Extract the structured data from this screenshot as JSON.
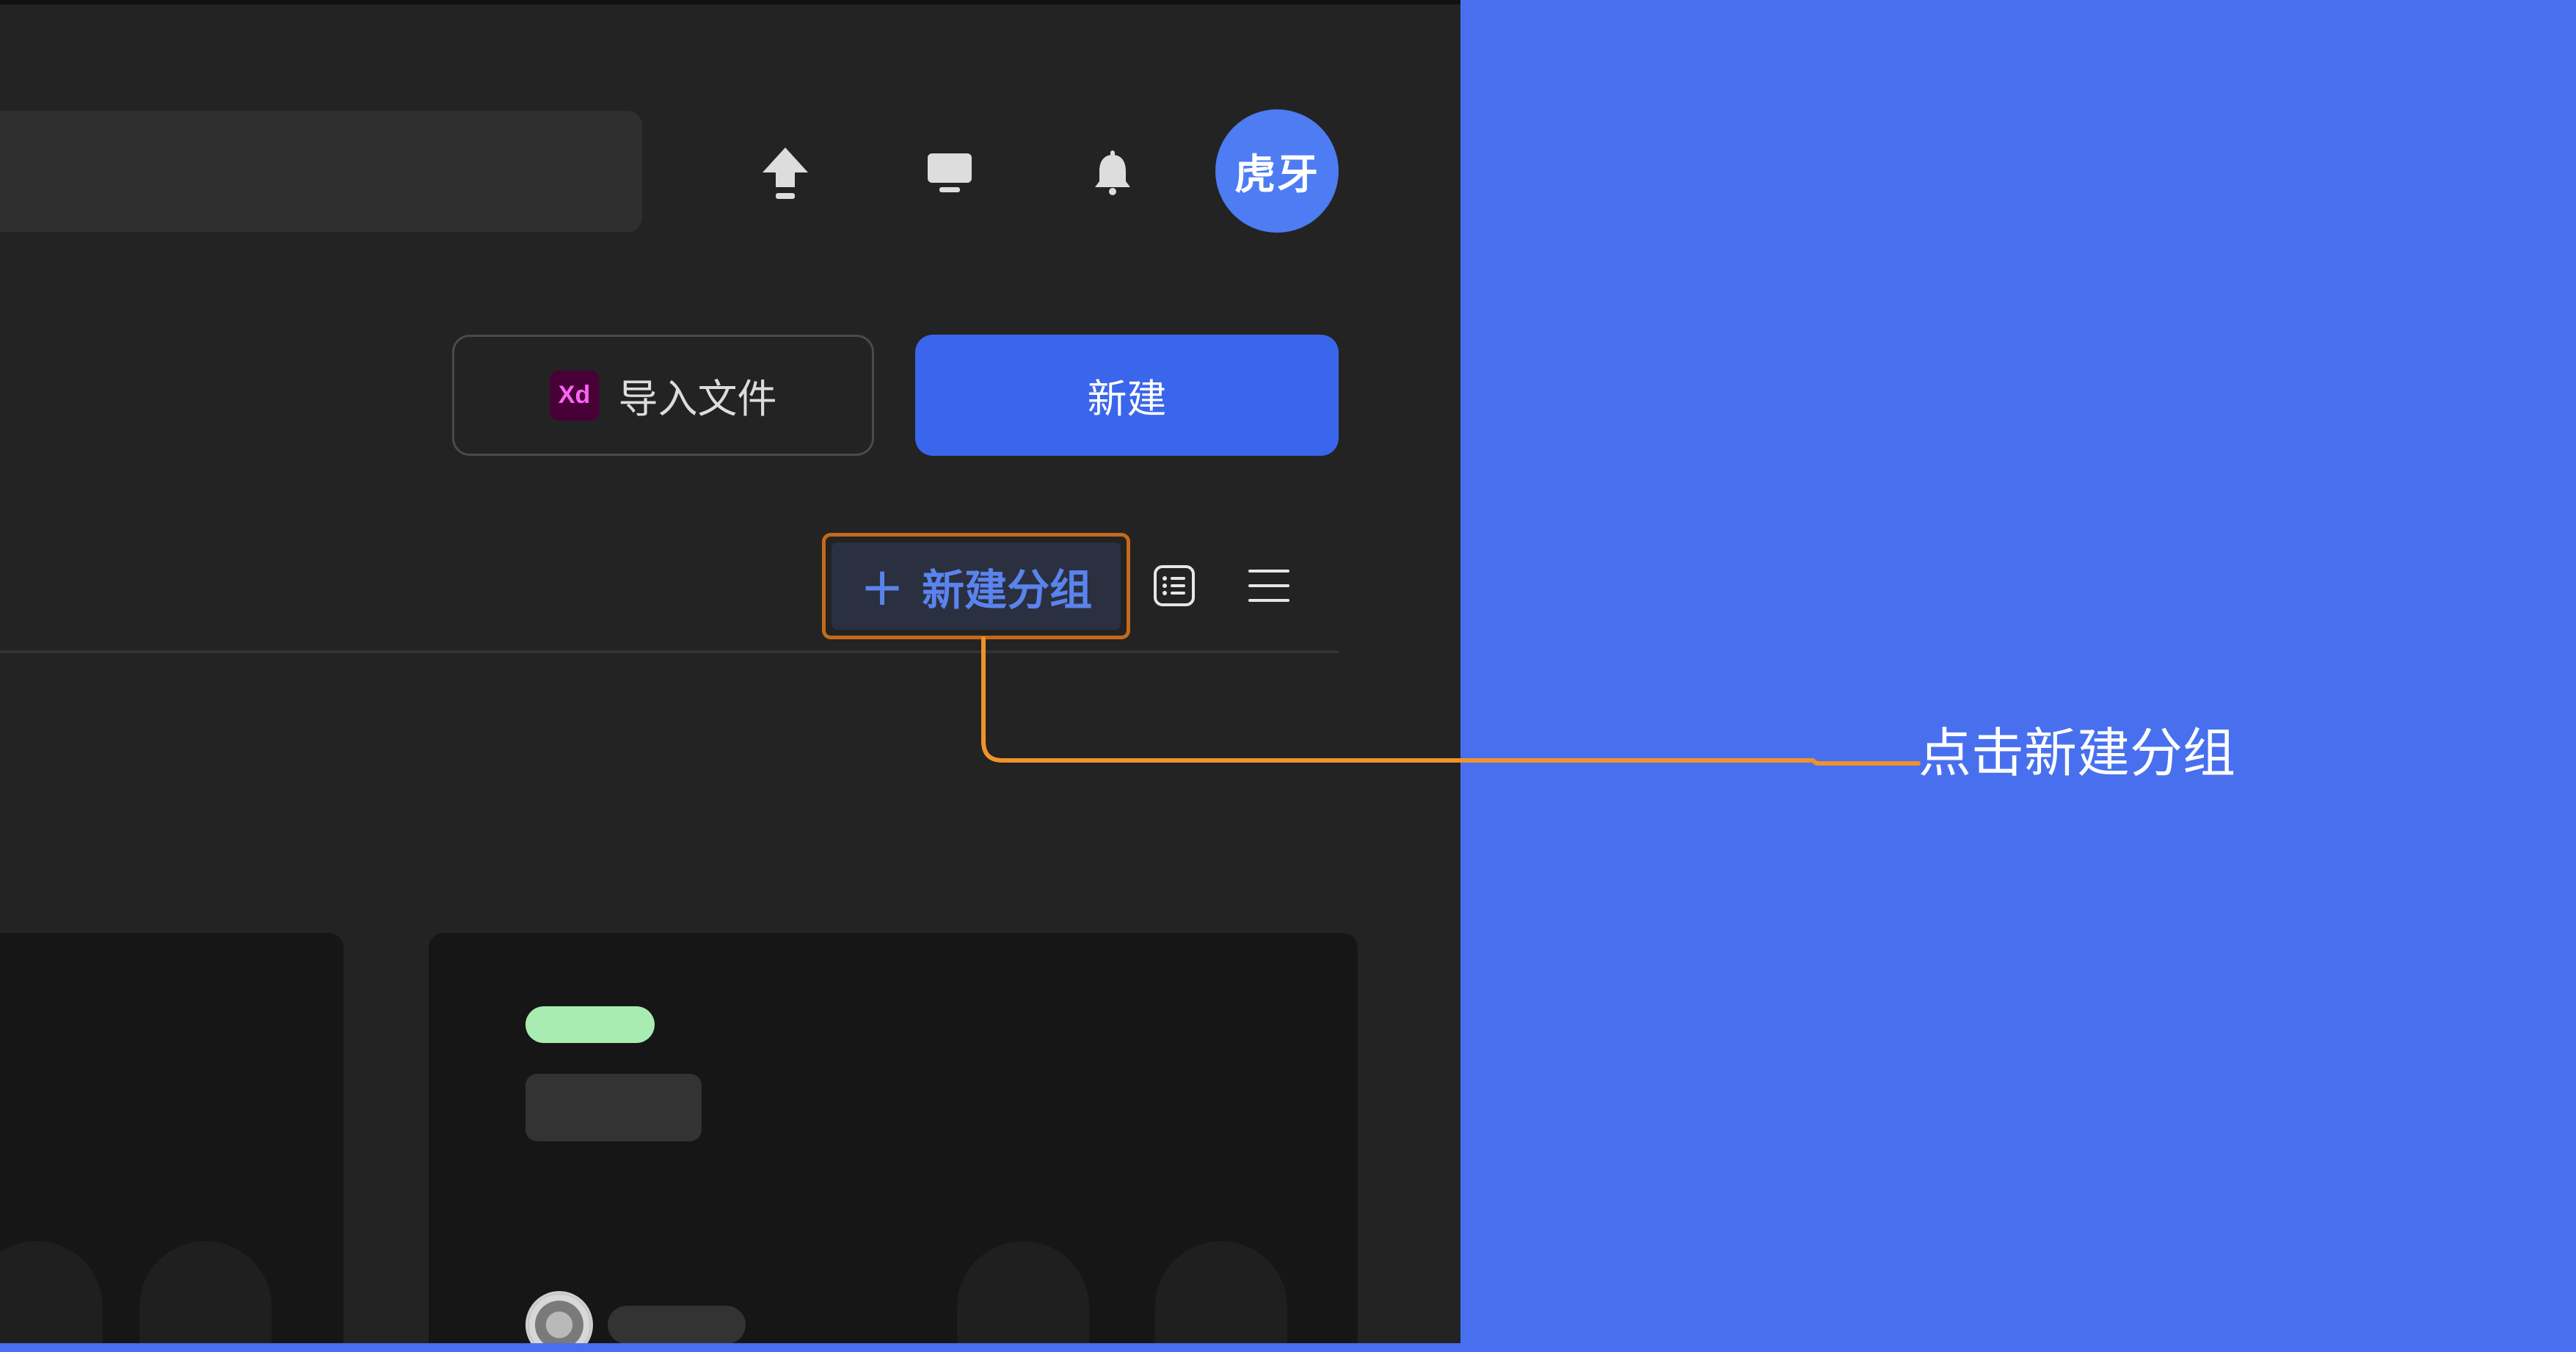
{
  "header": {
    "avatar_text": "虎牙",
    "icons": [
      "upload-icon",
      "monitor-icon",
      "bell-icon"
    ]
  },
  "actions": {
    "import_badge": "Xd",
    "import_label": "导入文件",
    "new_label": "新建"
  },
  "toolbar": {
    "new_group_plus": "+",
    "new_group_label": "新建分组",
    "view_icons": [
      "list-card-icon",
      "menu-icon"
    ]
  },
  "annotation": {
    "label": "点击新建分组",
    "color": "#f0922b"
  },
  "colors": {
    "panel_bg": "#232323",
    "page_bg": "#4870ee",
    "primary": "#3a66ec",
    "badge_green": "#a8ecb2",
    "xd_bg": "#470137",
    "xd_fg": "#ff61f6",
    "highlight_border": "#c46a1a"
  }
}
